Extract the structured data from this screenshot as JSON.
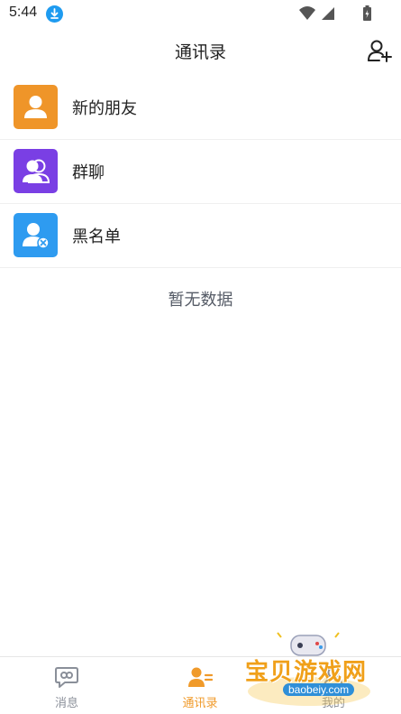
{
  "status_bar": {
    "time": "5:44"
  },
  "header": {
    "title": "通讯录",
    "add_icon": "add-user-icon"
  },
  "contact_items": [
    {
      "label": "新的朋友",
      "icon": "new-friend-icon",
      "color": "#ef9529"
    },
    {
      "label": "群聊",
      "icon": "group-chat-icon",
      "color": "#7a3fe4"
    },
    {
      "label": "黑名单",
      "icon": "blacklist-icon",
      "color": "#2e9bf0"
    }
  ],
  "empty_state": "暂无数据",
  "bottom_nav": [
    {
      "label": "消息",
      "icon": "message-icon",
      "active": false
    },
    {
      "label": "通讯录",
      "icon": "contacts-icon",
      "active": true
    },
    {
      "label": "我的",
      "icon": "profile-icon",
      "active": false
    }
  ],
  "watermark": {
    "text": "宝贝游戏网",
    "url": "baobeiy.com"
  },
  "colors": {
    "accent": "#f09a2a",
    "nav_inactive": "#8a8f99"
  }
}
